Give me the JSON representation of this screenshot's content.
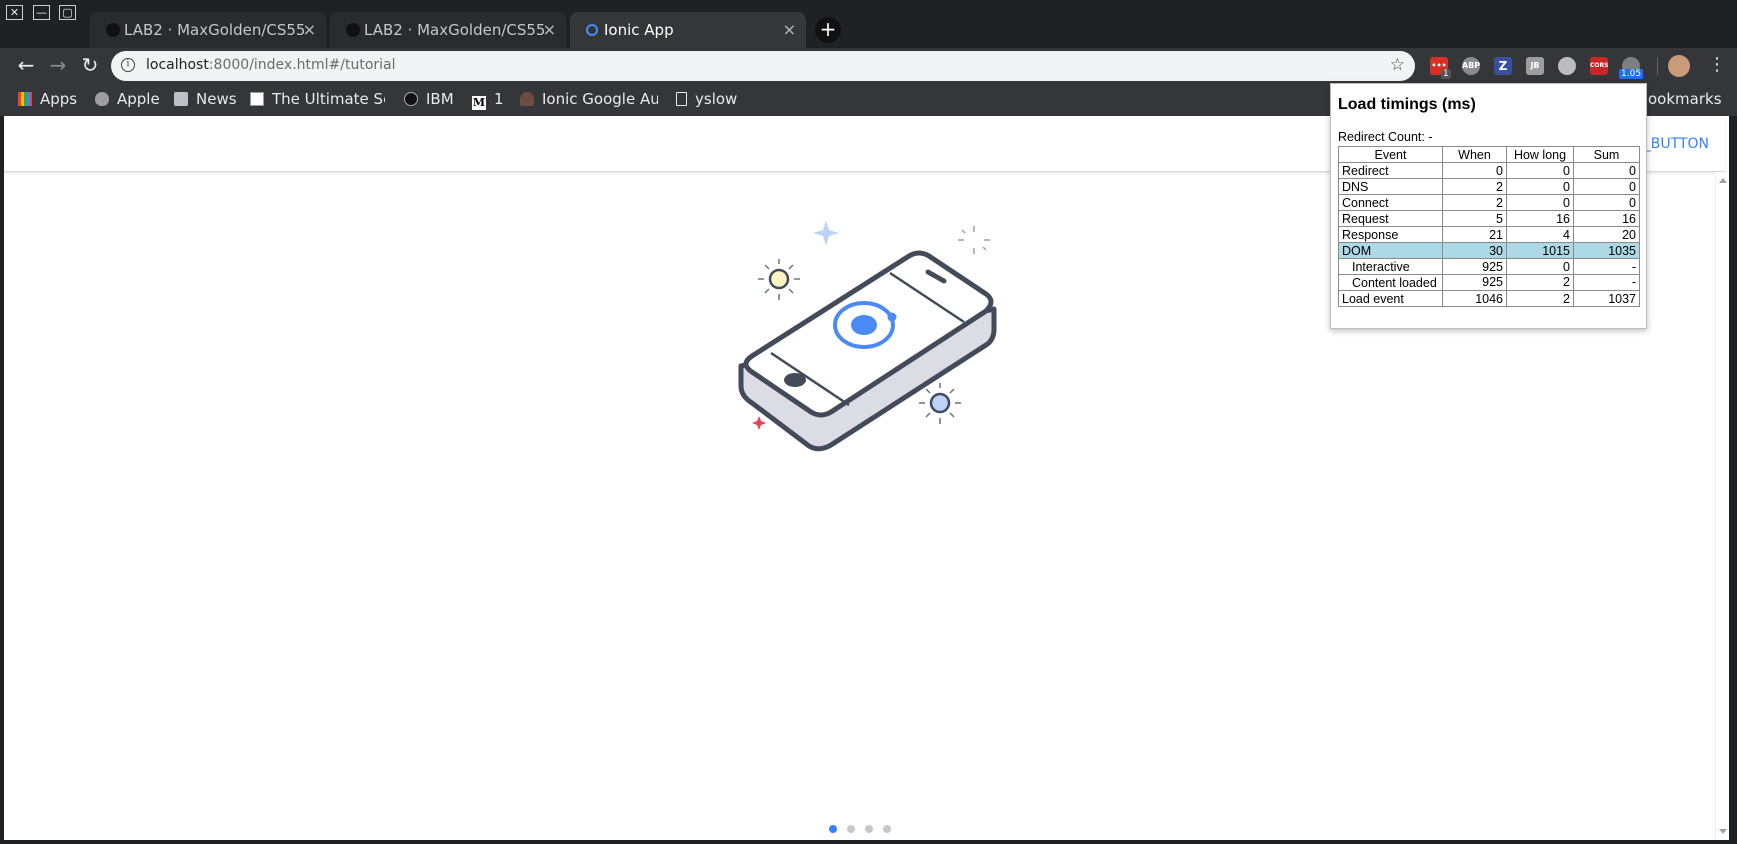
{
  "window": {
    "controls": [
      "✕",
      "—",
      "▢"
    ]
  },
  "tabs": [
    {
      "title": "LAB2 · MaxGolden/CS555",
      "close": "×",
      "active": false
    },
    {
      "title": "LAB2 · MaxGolden/CS555",
      "close": "×",
      "active": false
    },
    {
      "title": "Ionic App",
      "close": "×",
      "active": true
    }
  ],
  "new_tab_label": "+",
  "toolbar": {
    "url_host": "localhost",
    "url_rest": ":8000/index.html#/tutorial",
    "extensions": [
      {
        "name": "todo-extension-icon",
        "color": "#d93025",
        "badge": "1"
      },
      {
        "name": "adblock-plus-icon",
        "color": "#8a8a8a",
        "label": "ABP"
      },
      {
        "name": "zotero-icon",
        "color": "#3b4fa0",
        "label": "Z"
      },
      {
        "name": "jsonview-icon",
        "color": "#9e9e9e",
        "label": "JB"
      },
      {
        "name": "ghost-icon",
        "color": "#bdbdbd",
        "label": ""
      },
      {
        "name": "cors-icon",
        "color": "#c62828",
        "label": "CORS"
      },
      {
        "name": "load-timer-icon",
        "color": "#7f7f7f",
        "badge": "1.05"
      }
    ]
  },
  "bookmarks": [
    {
      "label": "Apps",
      "icon": "apps-grid-icon"
    },
    {
      "label": "Apple",
      "icon": "apple-icon"
    },
    {
      "label": "News",
      "icon": "folder-icon"
    },
    {
      "label": "The Ultimate Ser",
      "icon": "ultimate-icon"
    },
    {
      "label": "IBM",
      "icon": "github-icon"
    },
    {
      "label": "1",
      "icon": "medium-icon"
    },
    {
      "label": "Ionic Google Aut",
      "icon": "person-icon"
    },
    {
      "label": "yslow",
      "icon": "page-icon"
    },
    {
      "label": "ookmarks",
      "icon": "none"
    }
  ],
  "page": {
    "skip_label": "IP_BUTTON",
    "slide_count": 4,
    "active_slide": 0
  },
  "popup": {
    "title": "Load timings (ms)",
    "redirect": "Redirect Count: -",
    "headers": [
      "Event",
      "When",
      "How long",
      "Sum"
    ],
    "rows": [
      {
        "event": "Redirect",
        "when": "0",
        "how_long": "0",
        "sum": "0"
      },
      {
        "event": "DNS",
        "when": "2",
        "how_long": "0",
        "sum": "0"
      },
      {
        "event": "Connect",
        "when": "2",
        "how_long": "0",
        "sum": "0"
      },
      {
        "event": "Request",
        "when": "5",
        "how_long": "16",
        "sum": "16"
      },
      {
        "event": "Response",
        "when": "21",
        "how_long": "4",
        "sum": "20"
      },
      {
        "event": "DOM",
        "when": "30",
        "how_long": "1015",
        "sum": "1035",
        "highlight": true
      },
      {
        "event": "Interactive",
        "when": "925",
        "how_long": "0",
        "sum": "-",
        "indent": true
      },
      {
        "event": "Content loaded",
        "when": "925",
        "how_long": "2",
        "sum": "-",
        "indent": true
      },
      {
        "event": "Load event",
        "when": "1046",
        "how_long": "2",
        "sum": "1037"
      }
    ]
  }
}
